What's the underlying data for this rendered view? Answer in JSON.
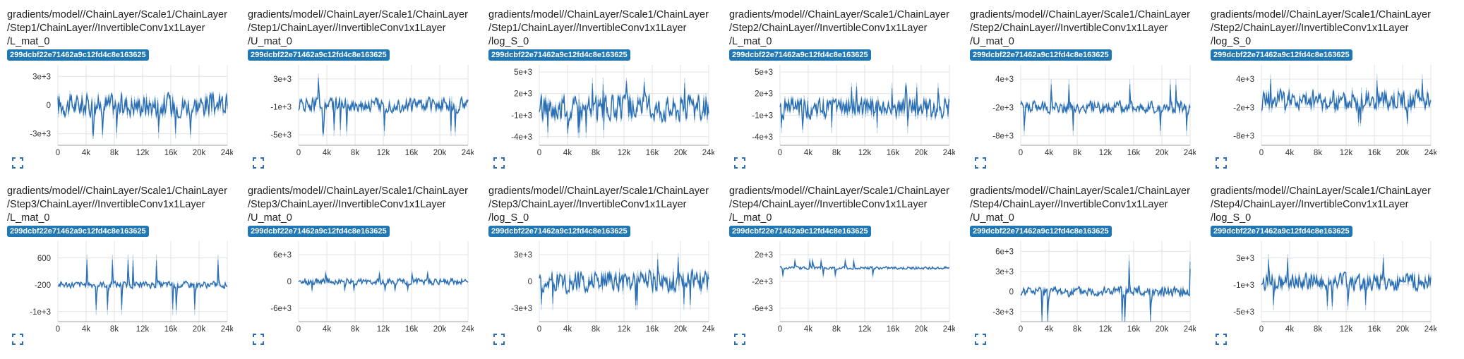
{
  "run_label": "299dcbf22e71462a9c12fd4c8e163625",
  "colors": {
    "series": "#2a6fb4",
    "shade": "#b9d3ea",
    "badge": "#1f77b4",
    "grid": "#e3e3e3",
    "axis": "#9e9e9e"
  },
  "icons": {
    "expand": "expand-icon"
  },
  "chart_data": [
    {
      "type": "line",
      "title_lines": [
        "gradients/model//ChainLayer/Scale1/ChainLayer",
        "/Step1/ChainLayer//InvertibleConv1x1Layer",
        "/L_mat_0"
      ],
      "x_ticks": [
        "0",
        "4k",
        "8k",
        "12k",
        "16k",
        "20k",
        "24k"
      ],
      "xlim": [
        0,
        24000
      ],
      "y_ticks": [
        {
          "label": "3e+3",
          "value": 3000
        },
        {
          "label": "0",
          "value": 0
        },
        {
          "label": "-3e+3",
          "value": -3000
        }
      ],
      "ylim": [
        -4200,
        4200
      ],
      "center": 0,
      "amp": 1500,
      "spike": 3500
    },
    {
      "type": "line",
      "title_lines": [
        "gradients/model//ChainLayer/Scale1/ChainLayer",
        "/Step1/ChainLayer//InvertibleConv1x1Layer",
        "/U_mat_0"
      ],
      "x_ticks": [
        "0",
        "4k",
        "8k",
        "12k",
        "16k",
        "20k",
        "24k"
      ],
      "xlim": [
        0,
        24000
      ],
      "y_ticks": [
        {
          "label": "3e+3",
          "value": 3000
        },
        {
          "label": "-1e+3",
          "value": -1000
        },
        {
          "label": "-5e+3",
          "value": -5000
        }
      ],
      "ylim": [
        -6500,
        5000
      ],
      "center": -700,
      "amp": 1300,
      "spike": 4500
    },
    {
      "type": "line",
      "title_lines": [
        "gradients/model//ChainLayer/Scale1/ChainLayer",
        "/Step1/ChainLayer//InvertibleConv1x1Layer",
        "/log_S_0"
      ],
      "x_ticks": [
        "0",
        "4k",
        "8k",
        "12k",
        "16k",
        "20k",
        "24k"
      ],
      "xlim": [
        0,
        24000
      ],
      "y_ticks": [
        {
          "label": "5e+3",
          "value": 5000
        },
        {
          "label": "2e+3",
          "value": 2000
        },
        {
          "label": "-1e+3",
          "value": -1000
        },
        {
          "label": "-4e+3",
          "value": -4000
        }
      ],
      "ylim": [
        -5200,
        6000
      ],
      "center": 0,
      "amp": 2200,
      "spike": 4200
    },
    {
      "type": "line",
      "title_lines": [
        "gradients/model//ChainLayer/Scale1/ChainLayer",
        "/Step2/ChainLayer//InvertibleConv1x1Layer",
        "/L_mat_0"
      ],
      "x_ticks": [
        "0",
        "4k",
        "8k",
        "12k",
        "16k",
        "20k",
        "24k"
      ],
      "xlim": [
        0,
        24000
      ],
      "y_ticks": [
        {
          "label": "5e+3",
          "value": 5000
        },
        {
          "label": "2e+3",
          "value": 2000
        },
        {
          "label": "-1e+3",
          "value": -1000
        },
        {
          "label": "-4e+3",
          "value": -4000
        }
      ],
      "ylim": [
        -5200,
        6000
      ],
      "center": 0,
      "amp": 1800,
      "spike": 3500
    },
    {
      "type": "line",
      "title_lines": [
        "gradients/model//ChainLayer/Scale1/ChainLayer",
        "/Step2/ChainLayer//InvertibleConv1x1Layer",
        "/U_mat_0"
      ],
      "x_ticks": [
        "0",
        "4k",
        "8k",
        "12k",
        "16k",
        "20k",
        "24k"
      ],
      "xlim": [
        0,
        24000
      ],
      "y_ticks": [
        {
          "label": "4e+3",
          "value": 4000
        },
        {
          "label": "-2e+3",
          "value": -2000
        },
        {
          "label": "-8e+3",
          "value": -8000
        }
      ],
      "ylim": [
        -10000,
        7000
      ],
      "center": -2000,
      "amp": 1600,
      "spike": 6000
    },
    {
      "type": "line",
      "title_lines": [
        "gradients/model//ChainLayer/Scale1/ChainLayer",
        "/Step2/ChainLayer//InvertibleConv1x1Layer",
        "/log_S_0"
      ],
      "x_ticks": [
        "0",
        "4k",
        "8k",
        "12k",
        "16k",
        "20k",
        "24k"
      ],
      "xlim": [
        0,
        24000
      ],
      "y_ticks": [
        {
          "label": "4e+3",
          "value": 4000
        },
        {
          "label": "-2e+3",
          "value": -2000
        },
        {
          "label": "-8e+3",
          "value": -8000
        }
      ],
      "ylim": [
        -10000,
        7000
      ],
      "center": -500,
      "amp": 2800,
      "spike": 5500
    },
    {
      "type": "line",
      "title_lines": [
        "gradients/model//ChainLayer/Scale1/ChainLayer",
        "/Step3/ChainLayer//InvertibleConv1x1Layer",
        "/L_mat_0"
      ],
      "x_ticks": [
        "0",
        "4k",
        "8k",
        "12k",
        "16k",
        "20k",
        "24k"
      ],
      "xlim": [
        0,
        24000
      ],
      "y_ticks": [
        {
          "label": "600",
          "value": 600
        },
        {
          "label": "-200",
          "value": -200
        },
        {
          "label": "-1e+3",
          "value": -1000
        }
      ],
      "ylim": [
        -1300,
        1100
      ],
      "center": -200,
      "amp": 120,
      "spike": 900
    },
    {
      "type": "line",
      "title_lines": [
        "gradients/model//ChainLayer/Scale1/ChainLayer",
        "/Step3/ChainLayer//InvertibleConv1x1Layer",
        "/U_mat_0"
      ],
      "x_ticks": [
        "0",
        "4k",
        "8k",
        "12k",
        "16k",
        "20k",
        "24k"
      ],
      "xlim": [
        0,
        24000
      ],
      "y_ticks": [
        {
          "label": "6e+3",
          "value": 6000
        },
        {
          "label": "0",
          "value": 0
        },
        {
          "label": "-6e+3",
          "value": -6000
        }
      ],
      "ylim": [
        -9000,
        9000
      ],
      "center": 0,
      "amp": 900,
      "spike": 2500
    },
    {
      "type": "line",
      "title_lines": [
        "gradients/model//ChainLayer/Scale1/ChainLayer",
        "/Step3/ChainLayer//InvertibleConv1x1Layer",
        "/log_S_0"
      ],
      "x_ticks": [
        "0",
        "4k",
        "8k",
        "12k",
        "16k",
        "20k",
        "24k"
      ],
      "xlim": [
        0,
        24000
      ],
      "y_ticks": [
        {
          "label": "3e+3",
          "value": 3000
        },
        {
          "label": "0",
          "value": 0
        },
        {
          "label": "-3e+3",
          "value": -3000
        }
      ],
      "ylim": [
        -4500,
        4500
      ],
      "center": 0,
      "amp": 1500,
      "spike": 3200
    },
    {
      "type": "line",
      "title_lines": [
        "gradients/model//ChainLayer/Scale1/ChainLayer",
        "/Step4/ChainLayer//InvertibleConv1x1Layer",
        "/L_mat_0"
      ],
      "x_ticks": [
        "0",
        "4k",
        "8k",
        "12k",
        "16k",
        "20k",
        "24k"
      ],
      "xlim": [
        0,
        24000
      ],
      "y_ticks": [
        {
          "label": "2e+3",
          "value": 2000
        },
        {
          "label": "-2e+3",
          "value": -2000
        },
        {
          "label": "-6e+3",
          "value": -6000
        }
      ],
      "ylim": [
        -8000,
        4000
      ],
      "center": 0,
      "amp": 250,
      "spike": 1500
    },
    {
      "type": "line",
      "title_lines": [
        "gradients/model//ChainLayer/Scale1/ChainLayer",
        "/Step4/ChainLayer//InvertibleConv1x1Layer",
        "/U_mat_0"
      ],
      "x_ticks": [
        "0",
        "4k",
        "8k",
        "12k",
        "16k",
        "20k",
        "24k"
      ],
      "xlim": [
        0,
        24000
      ],
      "y_ticks": [
        {
          "label": "6e+3",
          "value": 6000
        },
        {
          "label": "3e+3",
          "value": 3000
        },
        {
          "label": "0",
          "value": 0
        },
        {
          "label": "-3e+3",
          "value": -3000
        }
      ],
      "ylim": [
        -4500,
        7500
      ],
      "center": 0,
      "amp": 900,
      "spike": 5500
    },
    {
      "type": "line",
      "title_lines": [
        "gradients/model//ChainLayer/Scale1/ChainLayer",
        "/Step4/ChainLayer//InvertibleConv1x1Layer",
        "/log_S_0"
      ],
      "x_ticks": [
        "0",
        "4k",
        "8k",
        "12k",
        "16k",
        "20k",
        "24k"
      ],
      "xlim": [
        0,
        24000
      ],
      "y_ticks": [
        {
          "label": "3e+3",
          "value": 3000
        },
        {
          "label": "-1e+3",
          "value": -1000
        },
        {
          "label": "-5e+3",
          "value": -5000
        }
      ],
      "ylim": [
        -6500,
        5500
      ],
      "center": -600,
      "amp": 1600,
      "spike": 4200
    }
  ]
}
